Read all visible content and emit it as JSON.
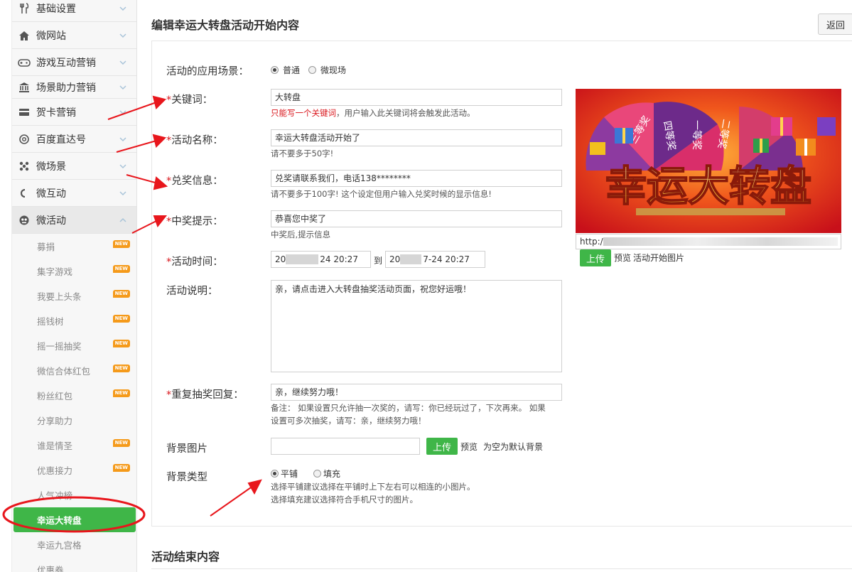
{
  "sidebar": {
    "menu": [
      {
        "label": "基础设置",
        "icon": "utensils-icon"
      },
      {
        "label": "微网站",
        "icon": "home-icon"
      },
      {
        "label": "游戏互动营销",
        "icon": "gamepad-icon"
      },
      {
        "label": "场景助力营销",
        "icon": "bank-icon"
      },
      {
        "label": "贺卡营销",
        "icon": "card-icon"
      },
      {
        "label": "百度直达号",
        "icon": "at-icon"
      },
      {
        "label": "微场景",
        "icon": "grid-icon"
      },
      {
        "label": "微互动",
        "icon": "link-icon"
      },
      {
        "label": "微活动",
        "icon": "mascot-icon"
      }
    ],
    "sub_items": [
      {
        "label": "募捐",
        "new": "NEW"
      },
      {
        "label": "集字游戏",
        "new": "NEW"
      },
      {
        "label": "我要上头条",
        "new": "NEW"
      },
      {
        "label": "摇钱树",
        "new": "NEW"
      },
      {
        "label": "摇一摇抽奖",
        "new": "NEW"
      },
      {
        "label": "微信合体红包",
        "new": "NEW"
      },
      {
        "label": "粉丝红包",
        "new": "NEW"
      },
      {
        "label": "分享助力",
        "new": ""
      },
      {
        "label": "谁是情圣",
        "new": "NEW"
      },
      {
        "label": "优惠接力",
        "new": "NEW"
      },
      {
        "label": "人气冲榜",
        "new": ""
      },
      {
        "label": "幸运大转盘",
        "new": ""
      },
      {
        "label": "幸运九宫格",
        "new": ""
      },
      {
        "label": "优惠券",
        "new": ""
      }
    ],
    "active_sub": "幸运大转盘"
  },
  "header": {
    "title": "编辑幸运大转盘活动开始内容",
    "back_label": "返回"
  },
  "form": {
    "scene": {
      "label": "活动的应用场景：",
      "options": [
        "普通",
        "微现场"
      ],
      "selected": "普通"
    },
    "keyword": {
      "req": "*",
      "label": "关键词：",
      "value": "大转盘",
      "hint_red": "只能写一个关键词",
      "hint": "，用户输入此关键词将会触发此活动。"
    },
    "name": {
      "req": "*",
      "label": "活动名称：",
      "value": "幸运大转盘活动开始了",
      "hint": "请不要多于50字!"
    },
    "prize_info": {
      "req": "*",
      "label": "兑奖信息：",
      "value": "兑奖请联系我们，电话138********",
      "hint": "请不要多于100字! 这个设定但用户输入兑奖时候的显示信息!"
    },
    "win_tip": {
      "req": "*",
      "label": "中奖提示：",
      "value": "恭喜您中奖了",
      "hint": "中奖后,提示信息"
    },
    "time": {
      "req": "*",
      "label": "活动时间：",
      "start_prefix": "20",
      "start_suffix": "24 20:27",
      "separator": "到",
      "end_prefix": "20",
      "end_suffix": "7-24 20:27"
    },
    "desc": {
      "label": "活动说明：",
      "value": "亲，请点击进入大转盘抽奖活动页面，祝您好运哦！"
    },
    "repeat": {
      "req": "*",
      "label": "重复抽奖回复：",
      "value": "亲，继续努力哦！",
      "hint_line1": "备注： 如果设置只允许抽一次奖的，请写：你已经玩过了，下次再来。 如果",
      "hint_line2": "设置可多次抽奖，请写：亲，继续努力哦！"
    },
    "bg_image": {
      "label": "背景图片",
      "upload_label": "上传",
      "preview_label": "预览",
      "hint": "为空为默认背景"
    },
    "bg_type": {
      "label": "背景类型",
      "options": [
        "平铺",
        "填充"
      ],
      "selected": "平铺",
      "hint_line1": "选择平铺建议选择在平铺时上下左右可以相连的小图片。",
      "hint_line2": "选择填充建议选择符合手机尺寸的图片。"
    }
  },
  "banner": {
    "title": "幸运大转盘",
    "wheel_labels": [
      "三等奖",
      "四等奖",
      "一等奖",
      "二等奖"
    ],
    "url_prefix": "http://",
    "upload_label": "上传",
    "preview_label": "预览",
    "caption": "活动开始图片"
  },
  "section2": {
    "title": "活动结束内容"
  },
  "colors": {
    "accent_green": "#3fb648",
    "required_red": "#d9161c",
    "annotation_red": "#e8161c",
    "new_badge": "#f59a1a"
  }
}
